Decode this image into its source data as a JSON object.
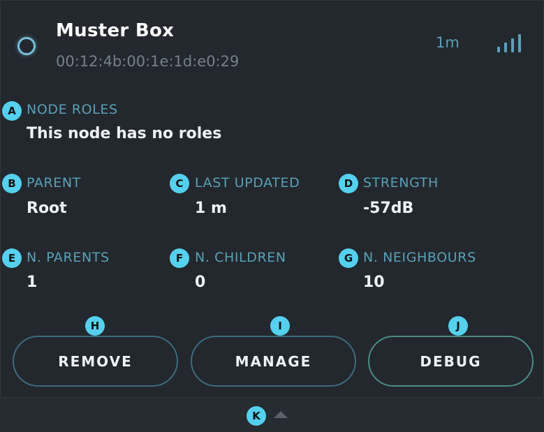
{
  "node": {
    "name": "Muster Box",
    "address": "00:12:4b:00:1e:1d:e0:29",
    "last_seen": "1m",
    "status_icon": "status-ring-icon",
    "signal_icon": "signal-bars-icon"
  },
  "fields": {
    "node_roles": {
      "label": "NODE ROLES",
      "value": "This node has no roles"
    },
    "parent": {
      "label": "PARENT",
      "value": "Root"
    },
    "last_updated": {
      "label": "LAST UPDATED",
      "value": "1 m"
    },
    "strength": {
      "label": "STRENGTH",
      "value": "-57dB"
    },
    "n_parents": {
      "label": "N. PARENTS",
      "value": "1"
    },
    "n_children": {
      "label": "N. CHILDREN",
      "value": "0"
    },
    "n_neighbours": {
      "label": "N. NEIGHBOURS",
      "value": "10"
    }
  },
  "actions": {
    "remove": "REMOVE",
    "manage": "MANAGE",
    "debug": "DEBUG"
  },
  "markers": {
    "a": "A",
    "b": "B",
    "c": "C",
    "d": "D",
    "e": "E",
    "f": "F",
    "g": "G",
    "h": "H",
    "i": "I",
    "j": "J",
    "k": "K"
  },
  "footer": {
    "expand_icon": "chevron-up-icon"
  },
  "colors": {
    "background": "#23282e",
    "accent": "#5aa0b8",
    "status_ring": "#79bfd9",
    "button_border": "#3c6c80",
    "debug_border": "#4b8c84",
    "marker": "#55d0ef"
  }
}
